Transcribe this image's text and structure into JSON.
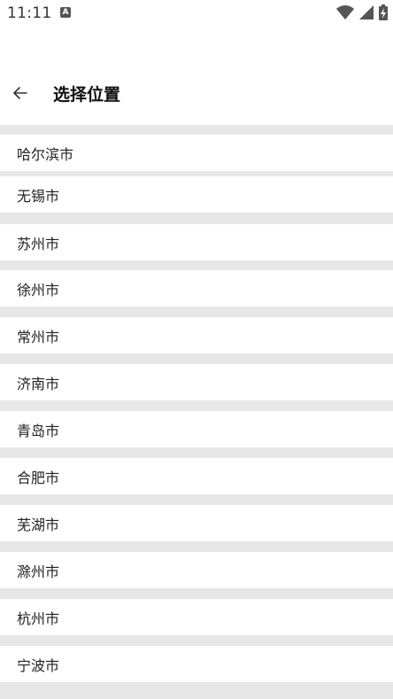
{
  "status_bar": {
    "time": "11:11",
    "notification_badge": "A"
  },
  "header": {
    "title": "选择位置"
  },
  "cities": [
    "哈尔滨市",
    "无锡市",
    "苏州市",
    "徐州市",
    "常州市",
    "济南市",
    "青岛市",
    "合肥市",
    "芜湖市",
    "滁州市",
    "杭州市",
    "宁波市"
  ],
  "colors": {
    "separator": "#e7e7e7",
    "background": "#ffffff",
    "text": "#222222"
  }
}
